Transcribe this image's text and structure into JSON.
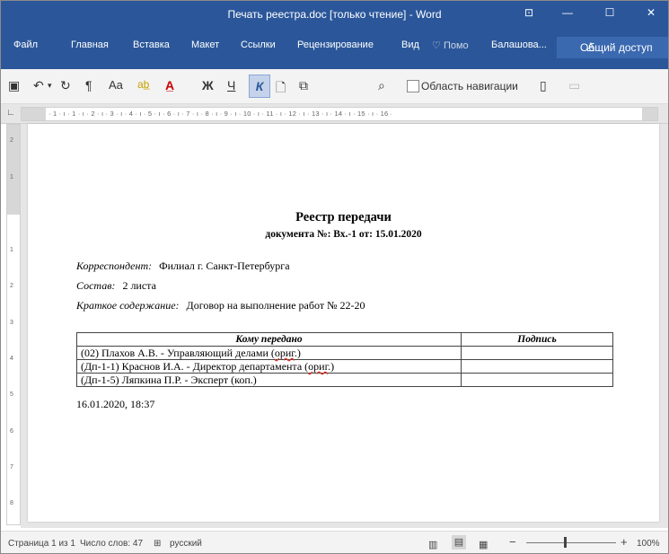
{
  "titlebar": {
    "title": "Печать реестра.doc [только чтение] - Word",
    "ribbon_display_icon": "⊡",
    "minimize": "—",
    "maximize": "☐",
    "close": "✕"
  },
  "ribbon": {
    "tabs": [
      "Файл",
      "Главная",
      "Вставка",
      "Макет",
      "Ссылки",
      "Рецензирование",
      "Вид"
    ],
    "tell_me": "Помо",
    "user": "Балашова...",
    "share": "Общий доступ"
  },
  "toolbar": {
    "nav_pane_label": "Область навигации"
  },
  "ruler": {
    "ticks": "· 1 · ı · 1 · ı · 2 · ı · 3 · ı · 4 · ı · 5 · ı · 6 · ı · 7 · ı · 8 · ı · 9 · ı · 10 · ı · 11 · ı · 12 · ı · 13 · ı · 14 · ı · 15 · ı · 16 ·"
  },
  "vruler": [
    "2",
    "1",
    "1",
    "2",
    "3",
    "4",
    "5",
    "6",
    "7",
    "8"
  ],
  "document": {
    "title": "Реестр передачи",
    "subtitle": "документа №: Вх.-1 от: 15.01.2020",
    "correspondent_label": "Корреспондент:",
    "correspondent_value": "Филиал г. Санкт-Петербурга",
    "composition_label": "Состав:",
    "composition_value": "2 листа",
    "summary_label": "Краткое содержание:",
    "summary_value": "Договор на выполнение работ № 22-20",
    "table": {
      "headers": [
        "Кому передано",
        "Подпись"
      ],
      "rows": [
        {
          "to_prefix": "(02) Плахов А.В. - Управляющий делами (",
          "to_mark": "ориг",
          "to_suffix": ".)",
          "sign": ""
        },
        {
          "to_prefix": "(Дп-1-1) Краснов И.А. - Директор департамента (",
          "to_mark": "ориг",
          "to_suffix": ".)",
          "sign": ""
        },
        {
          "to_prefix": "(Дп-1-5) Ляпкина П.Р. - Эксперт (коп.)",
          "to_mark": "",
          "to_suffix": "",
          "sign": ""
        }
      ]
    },
    "timestamp": "16.01.2020, 18:37"
  },
  "status": {
    "page": "Страница 1 из 1",
    "words": "Число слов: 47",
    "language": "русский",
    "zoom": "100%",
    "zoom_minus": "−",
    "zoom_plus": "+"
  }
}
